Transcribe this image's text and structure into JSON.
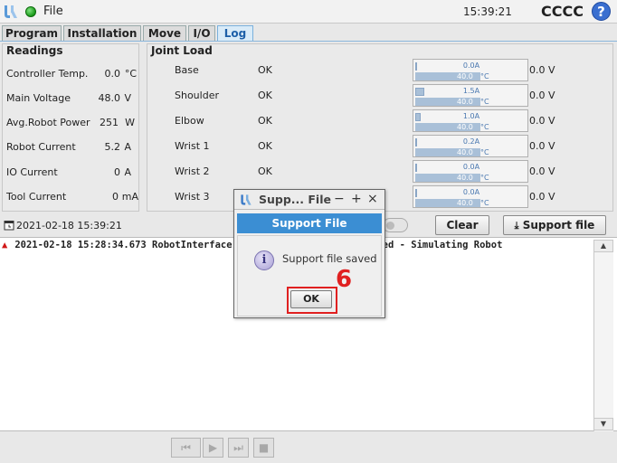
{
  "header": {
    "file_title": "File",
    "time": "15:39:21",
    "robot_name": "CCCC",
    "help_label": "?"
  },
  "tabs": [
    {
      "label": "Program"
    },
    {
      "label": "Installation"
    },
    {
      "label": "Move"
    },
    {
      "label": "I/O"
    },
    {
      "label": "Log"
    }
  ],
  "readings": {
    "title": "Readings",
    "rows": [
      {
        "label": "Controller Temp.",
        "value": "0.0",
        "unit": "°C"
      },
      {
        "label": "Main Voltage",
        "value": "48.0",
        "unit": "V"
      },
      {
        "label": "Avg.Robot Power",
        "value": "251",
        "unit": "W"
      },
      {
        "label": "Robot Current",
        "value": "5.2",
        "unit": "A"
      },
      {
        "label": "IO Current",
        "value": "0",
        "unit": "A"
      },
      {
        "label": "Tool Current",
        "value": "0",
        "unit": "mA"
      }
    ]
  },
  "joint_load": {
    "title": "Joint Load",
    "joints": [
      {
        "name": "Base",
        "status": "OK",
        "current": "0.0",
        "current_unit": "A",
        "current_fraction": 0.0,
        "temp": "40.0",
        "temp_unit": "°C",
        "voltage": "0.0 V"
      },
      {
        "name": "Shoulder",
        "status": "OK",
        "current": "1.5",
        "current_unit": "A",
        "current_fraction": 0.08,
        "temp": "40.0",
        "temp_unit": "°C",
        "voltage": "0.0 V"
      },
      {
        "name": "Elbow",
        "status": "OK",
        "current": "1.0",
        "current_unit": "A",
        "current_fraction": 0.05,
        "temp": "40.0",
        "temp_unit": "°C",
        "voltage": "0.0 V"
      },
      {
        "name": "Wrist 1",
        "status": "OK",
        "current": "0.2",
        "current_unit": "A",
        "current_fraction": 0.01,
        "temp": "40.0",
        "temp_unit": "°C",
        "voltage": "0.0 V"
      },
      {
        "name": "Wrist 2",
        "status": "OK",
        "current": "0.0",
        "current_unit": "A",
        "current_fraction": 0.0,
        "temp": "40.0",
        "temp_unit": "°C",
        "voltage": "0.0 V"
      },
      {
        "name": "Wrist 3",
        "status": "",
        "current": "0.0",
        "current_unit": "A",
        "current_fraction": 0.0,
        "temp": "40.0",
        "temp_unit": "°C",
        "voltage": "0.0 V"
      }
    ]
  },
  "log": {
    "date": "2021-02-18 15:39:21",
    "clear_label": "Clear",
    "support_label": "Support file",
    "entries": [
      {
        "left": "2021-02-18 15:28:34.673 RobotInterface",
        "right": "cted - Simulating Robot"
      }
    ]
  },
  "playback": {
    "buttons": [
      "⏮",
      "▶",
      "⏭",
      "■"
    ]
  },
  "dialog": {
    "window_title": "Supp... File",
    "min": "−",
    "max": "+",
    "close": "×",
    "header": "Support File",
    "icon_glyph": "i",
    "message": "Support file saved",
    "ok_label": "OK"
  },
  "annotation": {
    "step": "6"
  },
  "colors": {
    "accent": "#3b8ed3",
    "highlight": "#e02020",
    "status_ok": "#1a9a1a"
  }
}
